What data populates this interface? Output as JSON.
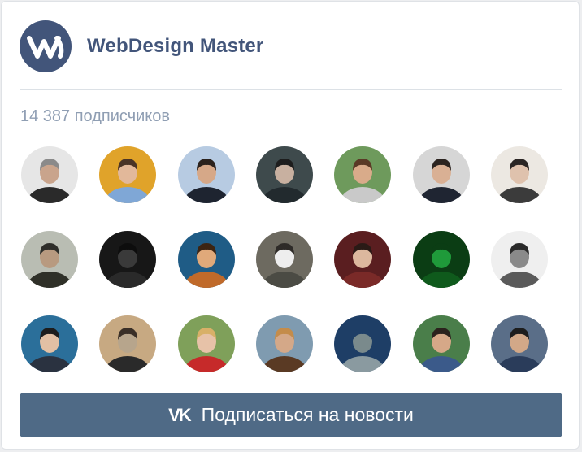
{
  "group": {
    "name": "WebDesign Master",
    "logo_color": "#42557a",
    "subscribers_text": "14 387 подписчиков"
  },
  "subscribers": [
    {
      "icon": "avatar-gray-hair-man",
      "bg": "#e6e6e6",
      "skin": "#c9a48c",
      "hair": "#8a8a8a",
      "shirt": "#2a2a2a"
    },
    {
      "icon": "avatar-colorful-wall-man",
      "bg": "#e0a32a",
      "skin": "#e2b89a",
      "hair": "#4a3426",
      "shirt": "#7fa7d6"
    },
    {
      "icon": "avatar-man-arms-crossed",
      "bg": "#b7cbe2",
      "skin": "#d6a888",
      "hair": "#2b221d",
      "shirt": "#1e2430"
    },
    {
      "icon": "avatar-dark-hood",
      "bg": "#3e4a4c",
      "skin": "#c8b0a0",
      "hair": "#1d1d1d",
      "shirt": "#222a2e"
    },
    {
      "icon": "avatar-sunglasses-man",
      "bg": "#6e9a5c",
      "skin": "#d9ab8a",
      "hair": "#5a3a26",
      "shirt": "#c9c9c9"
    },
    {
      "icon": "avatar-suit-man",
      "bg": "#d6d6d6",
      "skin": "#d9b094",
      "hair": "#2c2420",
      "shirt": "#1f2532"
    },
    {
      "icon": "avatar-two-faces",
      "bg": "#ece8e2",
      "skin": "#dfc2ad",
      "hair": "#2b2624",
      "shirt": "#3b3b3b"
    },
    {
      "icon": "avatar-dark-coat",
      "bg": "#b9bdb3",
      "skin": "#b89a80",
      "hair": "#2e2e2a",
      "shirt": "#2f3028"
    },
    {
      "icon": "avatar-night-car",
      "bg": "#171717",
      "skin": "#3a3a3a",
      "hair": "#0d0d0d",
      "shirt": "#2a2a2a"
    },
    {
      "icon": "avatar-fantasy-art",
      "bg": "#1f5c86",
      "skin": "#e0a97a",
      "hair": "#3c2412",
      "shirt": "#c06a2a"
    },
    {
      "icon": "avatar-joker-face",
      "bg": "#6d6a60",
      "skin": "#eeeeee",
      "hair": "#2e2b28",
      "shirt": "#4b4b44"
    },
    {
      "icon": "avatar-red-coat",
      "bg": "#5a1e20",
      "skin": "#dcb89e",
      "hair": "#2a1a16",
      "shirt": "#7a2a28"
    },
    {
      "icon": "avatar-matrix",
      "bg": "#0b3d14",
      "skin": "#1f9a3a",
      "hair": "#0b3d14",
      "shirt": "#0f5a1c"
    },
    {
      "icon": "avatar-bw-man",
      "bg": "#efefef",
      "skin": "#8a8a8a",
      "hair": "#2a2a2a",
      "shirt": "#5a5a5a"
    },
    {
      "icon": "avatar-cap-man",
      "bg": "#2b6f9a",
      "skin": "#e2c0a4",
      "hair": "#1d1d1d",
      "shirt": "#2a3240"
    },
    {
      "icon": "avatar-sword-figure",
      "bg": "#c7a982",
      "skin": "#b7a58c",
      "hair": "#3a2f27",
      "shirt": "#2a2a2a"
    },
    {
      "icon": "avatar-red-dress-woman",
      "bg": "#7fa05a",
      "skin": "#e7c2a8",
      "hair": "#d8b068",
      "shirt": "#c62a2a"
    },
    {
      "icon": "avatar-guitar-player",
      "bg": "#7f9bb0",
      "skin": "#d4a888",
      "hair": "#c48c4a",
      "shirt": "#5a3a24"
    },
    {
      "icon": "avatar-sea-landscape",
      "bg": "#1e3e66",
      "skin": "#7a8a8c",
      "hair": "#1e3e66",
      "shirt": "#8a9aa0"
    },
    {
      "icon": "avatar-man-sitting",
      "bg": "#4a7e4a",
      "skin": "#d6a888",
      "hair": "#2b221d",
      "shirt": "#3b5a8a"
    },
    {
      "icon": "avatar-headphones-man",
      "bg": "#5a6e88",
      "skin": "#d2a888",
      "hair": "#1d1d1d",
      "shirt": "#2a3c5a"
    }
  ],
  "button": {
    "icon": "vk-logo-icon",
    "icon_text": "VK",
    "label": "Подписаться на новости",
    "color": "#4f6a86"
  }
}
